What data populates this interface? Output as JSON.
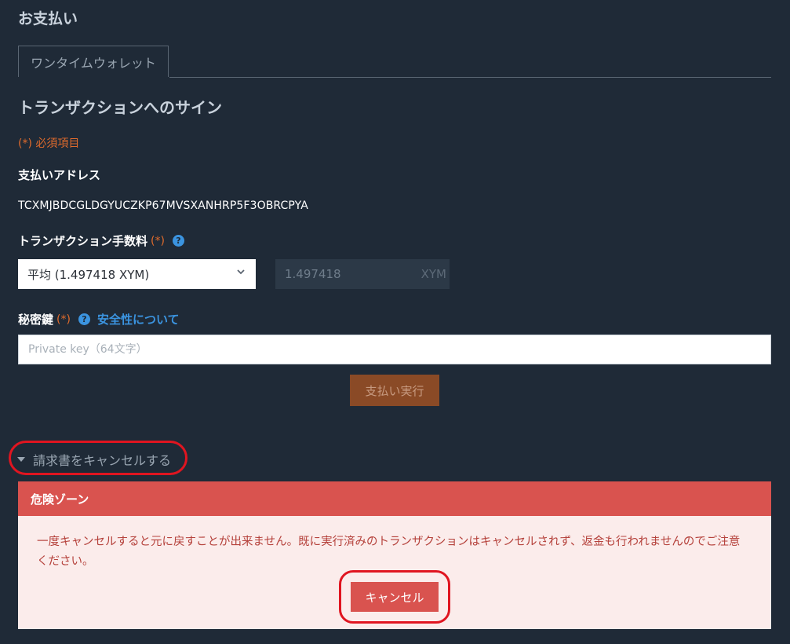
{
  "page_title": "お支払い",
  "tabs": [
    {
      "label": "ワンタイムウォレット"
    }
  ],
  "section_title": "トランザクションへのサイン",
  "required_note": "(*) 必須項目",
  "address": {
    "label": "支払いアドレス",
    "value": "TCXMJBDCGLDGYUCZKP67MVSXANHRP5F3OBRCPYA"
  },
  "fee": {
    "label": "トランザクション手数料",
    "required_mark": "(*)",
    "select_value": "平均 (1.497418 XYM)",
    "amount": "1.497418",
    "unit": "XYM"
  },
  "private_key": {
    "label": "秘密鍵",
    "required_mark": "(*)",
    "security_link": "安全性について",
    "placeholder": "Private key（64文字）"
  },
  "pay_button": "支払い実行",
  "cancel_section": {
    "toggle_label": "請求書をキャンセルする",
    "danger_title": "危険ゾーン",
    "danger_text": "一度キャンセルすると元に戻すことが出来ません。既に実行済みのトランザクションはキャンセルされず、返金も行われませんのでご注意ください。",
    "cancel_button": "キャンセル"
  },
  "colors": {
    "background": "#1f2a37",
    "accent_orange": "#e06b2c",
    "link_blue": "#3b94e0",
    "danger_red": "#d9534f",
    "highlight_oval": "#e01520"
  },
  "icons": [
    "help-icon",
    "chevron-down-icon",
    "caret-down-icon"
  ]
}
